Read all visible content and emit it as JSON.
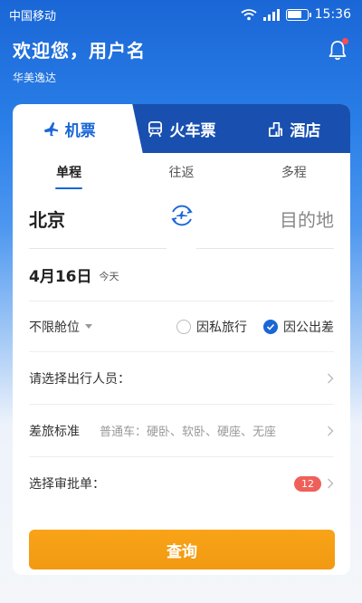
{
  "status_bar": {
    "carrier": "中国移动",
    "time": "15:36",
    "icons": [
      "wifi-icon",
      "signal-icon",
      "battery-icon"
    ]
  },
  "header": {
    "welcome": "欢迎您，用户名",
    "company": "华美逸达",
    "bell_icon": "bell-icon",
    "has_notification_dot": true
  },
  "tabs": [
    {
      "label": "机票",
      "icon": "plane-icon",
      "active": true
    },
    {
      "label": "火车票",
      "icon": "train-icon",
      "active": false
    },
    {
      "label": "酒店",
      "icon": "hotel-icon",
      "active": false
    }
  ],
  "trip_types": [
    {
      "label": "单程",
      "active": true
    },
    {
      "label": "往返",
      "active": false
    },
    {
      "label": "多程",
      "active": false
    }
  ],
  "route": {
    "from": "北京",
    "to_placeholder": "目的地",
    "swap_icon": "swap-plane-icon"
  },
  "date": {
    "main": "4月16日",
    "sub": "今天"
  },
  "options": {
    "cabin": "不限舱位",
    "purpose_private": "因私旅行",
    "purpose_business": "因公出差",
    "selected": "因公出差"
  },
  "rows": {
    "travelers_label": "请选择出行人员：",
    "policy_label": "差旅标准",
    "policy_value": "普通车：硬卧、软卧、硬座、无座",
    "approval_label": "选择审批单：",
    "approval_count": "12"
  },
  "query_button": "查询",
  "colors": {
    "primary": "#1a66d6",
    "tab_bar": "#1950b0",
    "button": "#f59e14",
    "badge": "#f0605a"
  }
}
